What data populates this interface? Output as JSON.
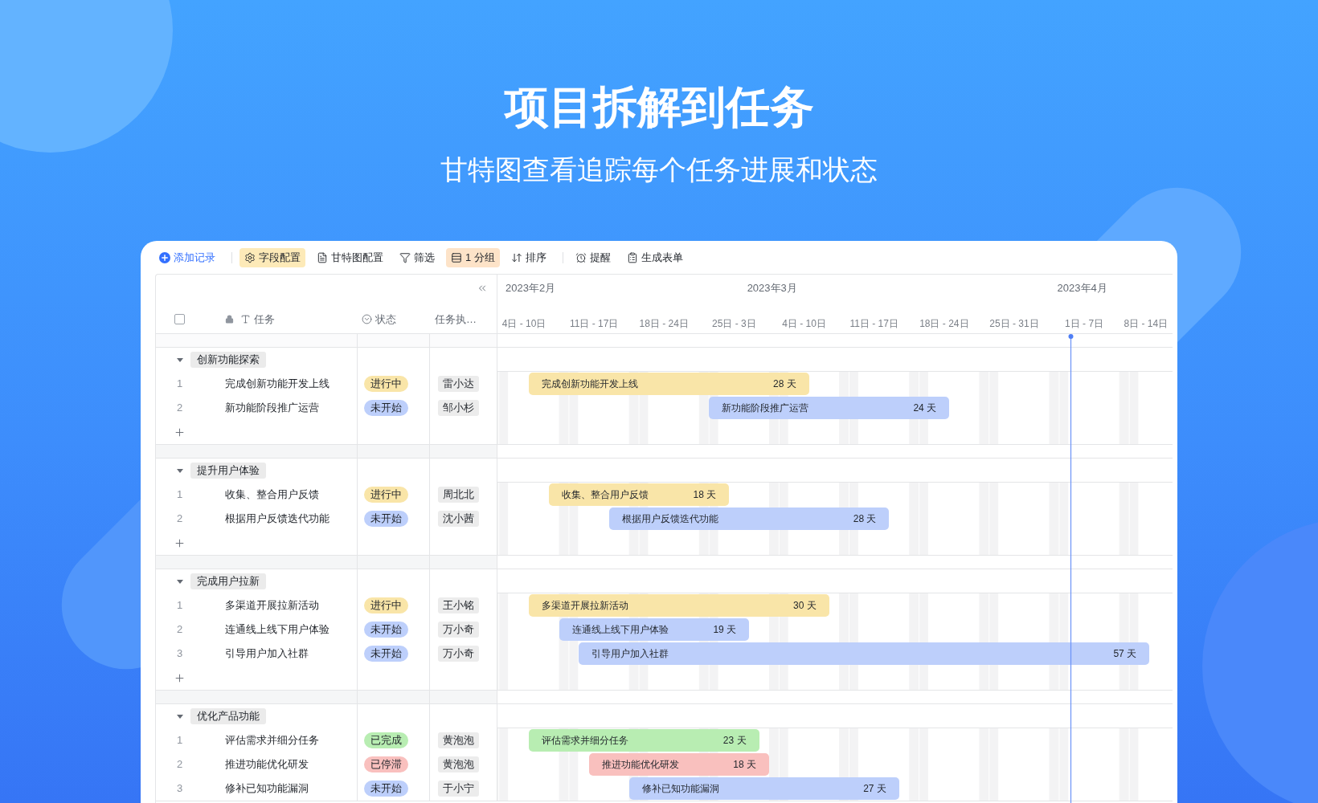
{
  "hero": {
    "title": "项目拆解到任务",
    "subtitle": "甘特图查看追踪每个任务进展和状态"
  },
  "toolbar": [
    {
      "kind": "primary",
      "label": "添加记录"
    },
    {
      "kind": "separator"
    },
    {
      "kind": "button",
      "label": "字段配置",
      "color": "#fdeab8"
    },
    {
      "kind": "button",
      "label": "甘特图配置"
    },
    {
      "kind": "button",
      "label": "筛选"
    },
    {
      "kind": "button",
      "label": "1 分组",
      "color": "#fde3c8"
    },
    {
      "kind": "button",
      "label": "排序"
    },
    {
      "kind": "separator"
    },
    {
      "kind": "button",
      "label": "提醒"
    },
    {
      "kind": "button",
      "label": "生成表单"
    }
  ],
  "table": {
    "select_all": {
      "checked": false
    },
    "columns": [
      {
        "kind": "text",
        "label": "任务",
        "locked": true
      },
      {
        "kind": "status",
        "label": "状态",
        "locked": false
      },
      {
        "kind": "person",
        "label": "任务执…",
        "locked": false
      }
    ]
  },
  "timeline": {
    "months": [
      "2023年2月",
      "2023年3月",
      "2023年4月"
    ],
    "weeks": [
      "4日 - 10日",
      "11日 - 17日",
      "18日 - 24日",
      "25日 - 3日",
      "4日 - 10日",
      "11日 - 17日",
      "18日 - 24日",
      "25日 - 31日",
      "1日 - 7日",
      "8日 - 14日"
    ]
  },
  "groups": [
    {
      "label": "创新功能探索",
      "expanded": true,
      "add_row": true,
      "tasks": [
        {
          "number": "1",
          "name": "完成创新功能开发上线",
          "status": {
            "label": "进行中",
            "color": "#f9e5a8"
          },
          "assignee": "雷小达",
          "bar": {
            "label": "完成创新功能开发上线",
            "duration": "28 天"
          }
        },
        {
          "number": "2",
          "name": "新功能阶段推广运营",
          "status": {
            "label": "未开始",
            "color": "#bdcffb"
          },
          "assignee": "邹小杉",
          "bar": {
            "label": "新功能阶段推广运营",
            "duration": "24 天"
          }
        }
      ]
    },
    {
      "label": "提升用户体验",
      "expanded": true,
      "add_row": true,
      "tasks": [
        {
          "number": "1",
          "name": "收集、整合用户反馈",
          "status": {
            "label": "进行中",
            "color": "#f9e5a8"
          },
          "assignee": "周北北",
          "bar": {
            "label": "收集、整合用户反馈",
            "duration": "18 天"
          }
        },
        {
          "number": "2",
          "name": "根据用户反馈迭代功能",
          "status": {
            "label": "未开始",
            "color": "#bdcffb"
          },
          "assignee": "沈小茜",
          "bar": {
            "label": "根据用户反馈迭代功能",
            "duration": "28 天"
          }
        }
      ]
    },
    {
      "label": "完成用户拉新",
      "expanded": true,
      "add_row": true,
      "tasks": [
        {
          "number": "1",
          "name": "多渠道开展拉新活动",
          "status": {
            "label": "进行中",
            "color": "#f9e5a8"
          },
          "assignee": "王小铭",
          "bar": {
            "label": "多渠道开展拉新活动",
            "duration": "30 天"
          }
        },
        {
          "number": "2",
          "name": "连通线上线下用户体验",
          "status": {
            "label": "未开始",
            "color": "#bdcffb"
          },
          "assignee": "万小奇",
          "bar": {
            "label": "连通线上线下用户体验",
            "duration": "19 天"
          }
        },
        {
          "number": "3",
          "name": "引导用户加入社群",
          "status": {
            "label": "未开始",
            "color": "#bdcffb"
          },
          "assignee": "万小奇",
          "bar": {
            "label": "引导用户加入社群",
            "duration": "57 天"
          }
        }
      ]
    },
    {
      "label": "优化产品功能",
      "expanded": true,
      "add_row": false,
      "tasks": [
        {
          "number": "1",
          "name": "评估需求并细分任务",
          "status": {
            "label": "已完成",
            "color": "#b8edb2"
          },
          "assignee": "黄泡泡",
          "bar": {
            "label": "评估需求并细分任务",
            "duration": "23 天"
          }
        },
        {
          "number": "2",
          "name": "推进功能优化研发",
          "status": {
            "label": "已停滞",
            "color": "#f9c0be"
          },
          "assignee": "黄泡泡",
          "bar": {
            "label": "推进功能优化研发",
            "duration": "18 天"
          }
        },
        {
          "number": "3",
          "name": "修补已知功能漏洞",
          "status": {
            "label": "未开始",
            "color": "#bdcffb"
          },
          "assignee": "于小宁",
          "bar": {
            "label": "修补已知功能漏洞",
            "duration": "27 天"
          }
        }
      ]
    }
  ]
}
